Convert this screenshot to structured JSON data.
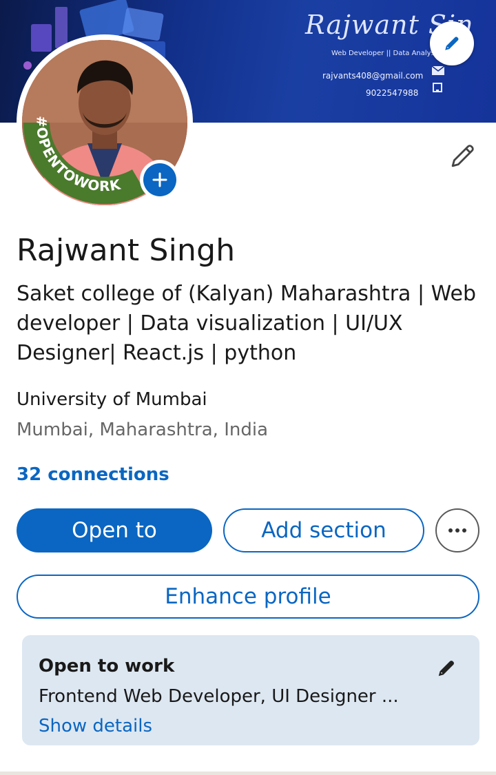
{
  "banner": {
    "name": "Rajwant Sin",
    "subtitle": "Web Developer || Data Analys",
    "email": "rajvants408@gmail.com",
    "phone": "9022547988",
    "background_color": "#12308a"
  },
  "avatar": {
    "badge_text": "#OPENTOWORK",
    "badge_color": "#4a7a2c"
  },
  "profile": {
    "name": "Rajwant Singh",
    "headline": "Saket college of (Kalyan) Maharashtra | Web developer | Data visualization | UI/UX Designer| React.js | python",
    "education": "University of Mumbai",
    "location": "Mumbai, Maharashtra, India",
    "connections": "32 connections"
  },
  "actions": {
    "open_to": "Open to",
    "add_section": "Add section",
    "enhance_profile": "Enhance profile"
  },
  "open_to_work": {
    "title": "Open to work",
    "roles": "Frontend Web Developer, UI Designer ...",
    "show_details": "Show details"
  },
  "icons": {
    "banner_edit": "pencil-icon",
    "add_photo": "plus-icon",
    "intro_edit": "pencil-icon",
    "more": "ellipsis-icon",
    "card_edit": "pencil-icon"
  },
  "colors": {
    "accent": "#0a66c2",
    "card_bg": "#dde7f1"
  }
}
